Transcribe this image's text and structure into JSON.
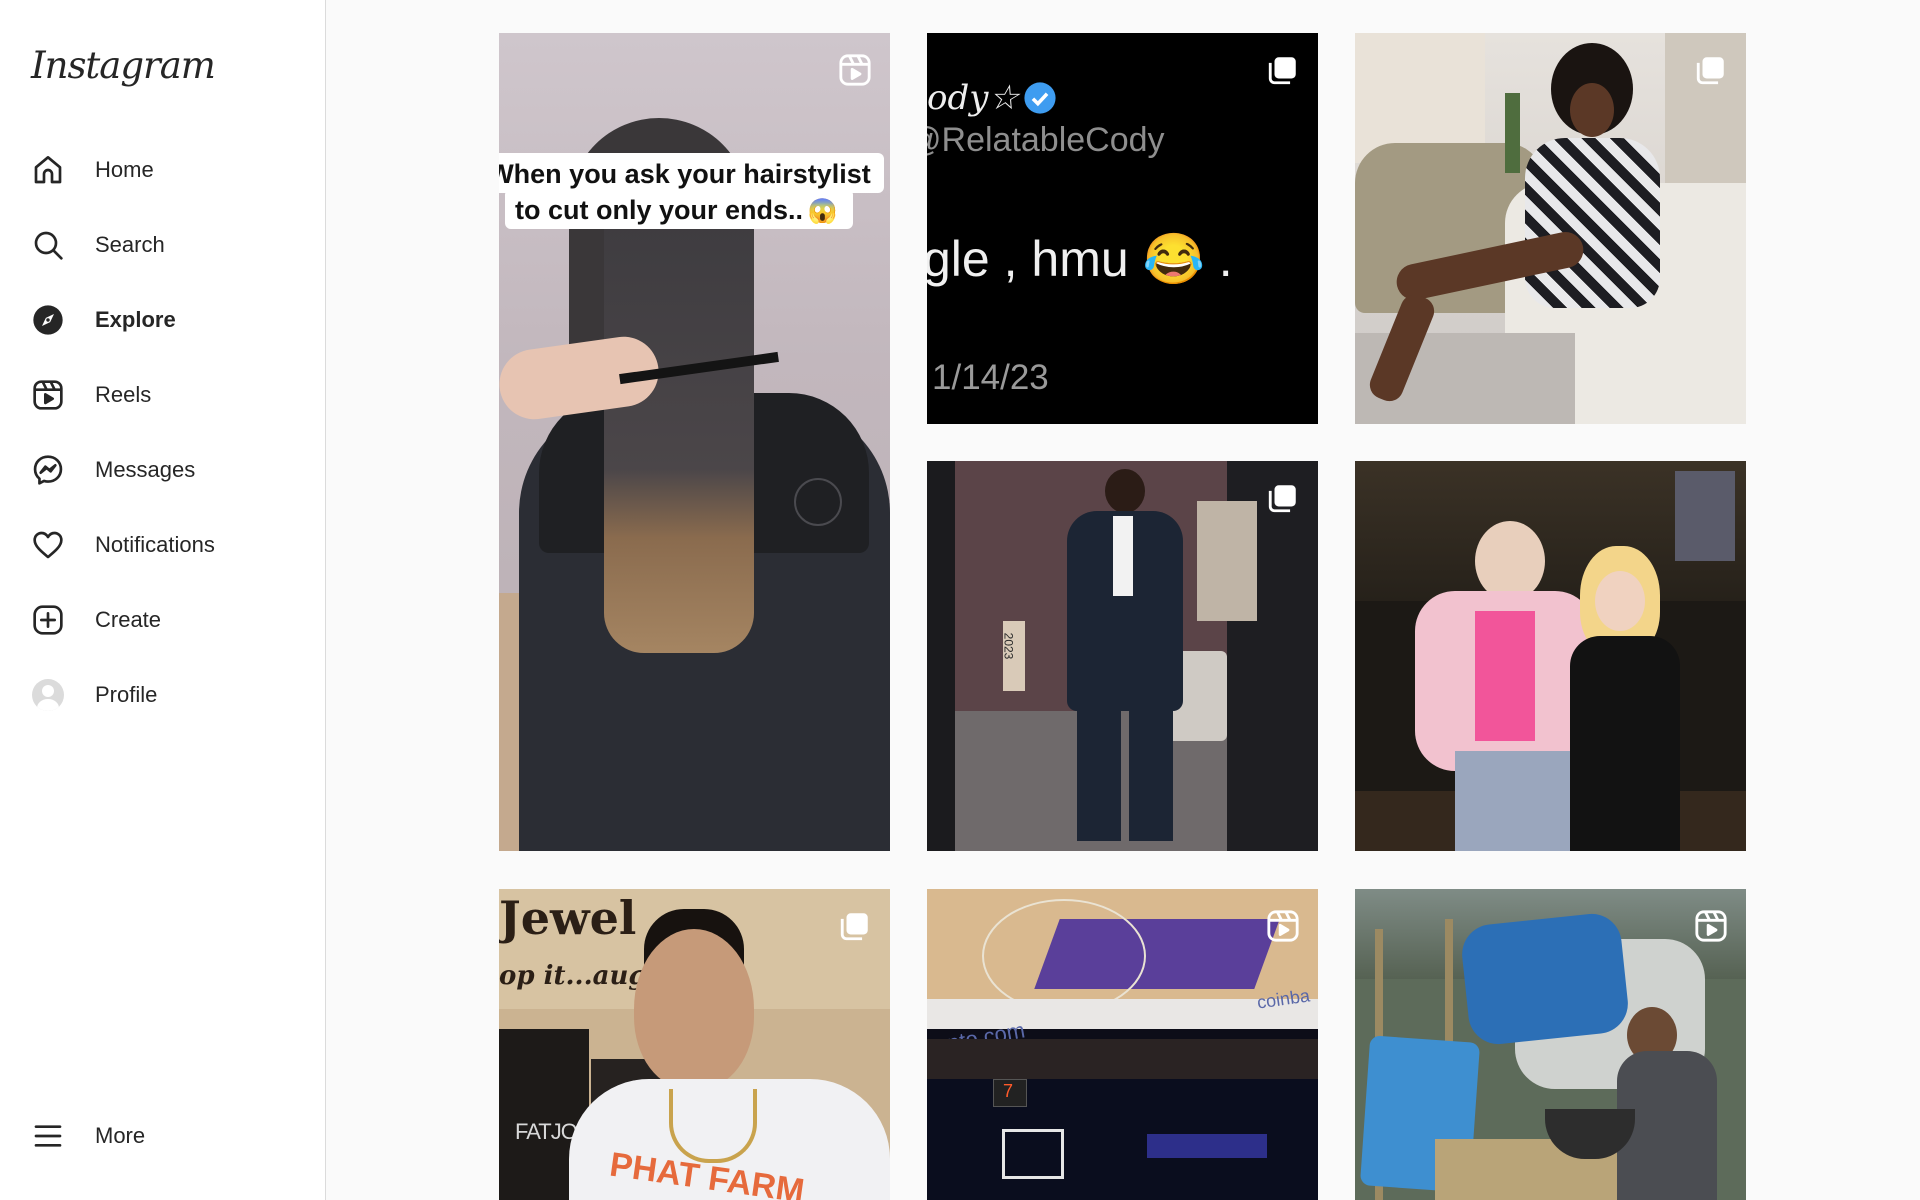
{
  "app": {
    "logo_text": "Instagram"
  },
  "sidebar": {
    "items": [
      {
        "id": "home",
        "label": "Home",
        "icon": "home-icon",
        "active": false
      },
      {
        "id": "search",
        "label": "Search",
        "icon": "search-icon",
        "active": false
      },
      {
        "id": "explore",
        "label": "Explore",
        "icon": "compass-icon",
        "active": true
      },
      {
        "id": "reels",
        "label": "Reels",
        "icon": "reels-icon",
        "active": false
      },
      {
        "id": "messages",
        "label": "Messages",
        "icon": "messenger-icon",
        "active": false
      },
      {
        "id": "notifications",
        "label": "Notifications",
        "icon": "heart-icon",
        "active": false
      },
      {
        "id": "create",
        "label": "Create",
        "icon": "plus-square-icon",
        "active": false
      },
      {
        "id": "profile",
        "label": "Profile",
        "icon": "avatar",
        "active": false
      }
    ],
    "more": {
      "label": "More",
      "icon": "hamburger-icon"
    }
  },
  "explore_grid": {
    "posts": [
      {
        "type": "reel",
        "badge": "reels-icon",
        "caption_line1": "When you ask your hairstylist",
        "caption_line2": "to cut only your ends..",
        "emoji": "😱"
      },
      {
        "type": "carousel",
        "badge": "carousel-icon",
        "tweet_name": "ody☆",
        "tweet_handle": "@RelatableCody",
        "tweet_text": "gle , hmu 😂 .",
        "tweet_date": "1/14/23"
      },
      {
        "type": "carousel",
        "badge": "carousel-icon"
      },
      {
        "type": "carousel",
        "badge": "carousel-icon",
        "photo_text": "2023"
      },
      {
        "type": "photo",
        "badge": null
      },
      {
        "type": "carousel",
        "badge": "carousel-icon",
        "sign_text_1": "Jewel",
        "sign_text_2": "op it...aug.",
        "label_text": "FATJOE",
        "shirt_text": "PHAT FARM"
      },
      {
        "type": "reel",
        "badge": "reels-icon",
        "court_text": "pto.com",
        "court_text_2": "coinba",
        "scoreboard_text": "7"
      },
      {
        "type": "reel",
        "badge": "reels-icon"
      }
    ]
  },
  "colors": {
    "text": "#262626",
    "border": "#dbdbdb",
    "background": "#fafafa",
    "verified": "#0095f6"
  }
}
